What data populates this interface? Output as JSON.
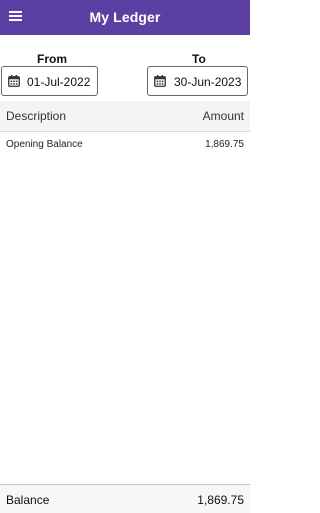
{
  "app_bar": {
    "title": "My Ledger",
    "menu_icon": "hamburger-menu-icon",
    "background": "#5c3fa3"
  },
  "date_range": {
    "from_label": "From",
    "from_value": "01-Jul-2022",
    "to_label": "To",
    "to_value": "30-Jun-2023",
    "icon": "calendar-icon"
  },
  "table": {
    "headers": {
      "description": "Description",
      "amount": "Amount"
    },
    "rows": [
      {
        "description": "Opening Balance",
        "amount": "1,869.75"
      }
    ]
  },
  "footer": {
    "label": "Balance",
    "amount": "1,869.75"
  }
}
